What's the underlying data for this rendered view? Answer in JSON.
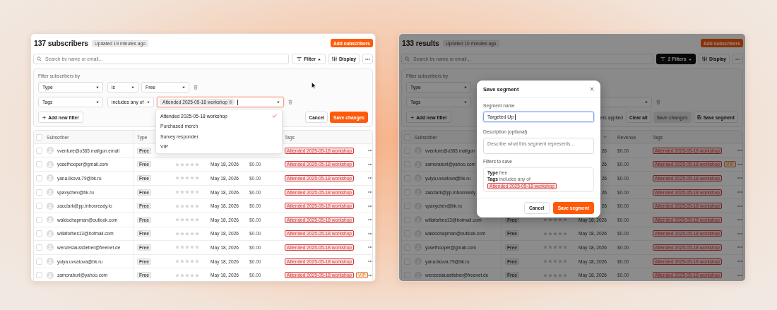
{
  "panels": [
    {
      "kind": "filtering",
      "header": {
        "title": "137 subscribers",
        "updated": "Updated 19 minutes ago",
        "add_button": "Add subscribers"
      },
      "toolbar": {
        "search_placeholder": "Search by name or email...",
        "filter_button": {
          "label": "Filter",
          "active": false
        },
        "display_button": "Display"
      },
      "filter_panel": {
        "heading": "Filter subscribers by",
        "rows": [
          {
            "kind": "select",
            "field": "Type",
            "operator": "is",
            "value": "Free"
          },
          {
            "kind": "tags",
            "field": "Tags",
            "operator": "includes any of",
            "chips": [
              "Attended 2025-05-18 workshop"
            ],
            "focused": true
          }
        ],
        "add_filter": "Add new filter",
        "actions": [
          {
            "kind": "secondary",
            "label": "Cancel",
            "disabled": false
          },
          {
            "kind": "primary",
            "label": "Save changes",
            "disabled": false
          }
        ]
      },
      "dropdown": {
        "options": [
          {
            "label": "Attended 2025-05-18 workshop",
            "selected": true
          },
          {
            "label": "Purchased merch",
            "selected": false
          },
          {
            "label": "Survey responder",
            "selected": false
          },
          {
            "label": "VIP",
            "selected": false
          }
        ]
      },
      "table": {
        "all_checked": false,
        "columns": [
          {
            "label": "Subscriber"
          },
          {
            "label": "Type"
          },
          {},
          {},
          {},
          {
            "label": "Tags"
          }
        ],
        "rows": [
          {
            "checked": false,
            "email": "vventure@o365.mailgun.email",
            "type": "Free",
            "tags": [
              {
                "label": "Attended 2025-05-18 workshop",
                "color": "#d93b3b"
              }
            ]
          },
          {
            "checked": false,
            "email": "yosefhooper@gmail.com",
            "type": "Free",
            "stars": 0,
            "date": "May 18, 2026",
            "revenue": "$0.00",
            "tags": [
              {
                "label": "Attended 2025-05-18 workshop",
                "color": "#d93b3b"
              }
            ]
          },
          {
            "checked": false,
            "email": "yana.likova.79@bk.ru",
            "type": "Free",
            "stars": 0,
            "date": "May 18, 2026",
            "revenue": "$0.00",
            "tags": [
              {
                "label": "Attended 2025-05-18 workshop",
                "color": "#d93b3b"
              }
            ]
          },
          {
            "checked": false,
            "email": "vpavychev@bk.ru",
            "type": "Free",
            "stars": 0,
            "date": "May 18, 2026",
            "revenue": "$0.00",
            "tags": [
              {
                "label": "Attended 2025-05-18 workshop",
                "color": "#d93b3b"
              }
            ]
          },
          {
            "checked": false,
            "email": "zacclark@pp.inboxready.io",
            "type": "Free",
            "stars": 0,
            "date": "May 18, 2026",
            "revenue": "$0.00",
            "tags": [
              {
                "label": "Attended 2025-05-18 workshop",
                "color": "#d93b3b"
              }
            ]
          },
          {
            "checked": false,
            "email": "waldochapman@outlook.com",
            "type": "Free",
            "stars": 0,
            "date": "May 18, 2026",
            "revenue": "$0.00",
            "tags": [
              {
                "label": "Attended 2025-05-18 workshop",
                "color": "#d93b3b"
              }
            ]
          },
          {
            "checked": false,
            "email": "willaforbes13@hotmail.com",
            "type": "Free",
            "stars": 0,
            "date": "May 18, 2026",
            "revenue": "$0.00",
            "tags": [
              {
                "label": "Attended 2025-05-18 workshop",
                "color": "#d93b3b"
              }
            ]
          },
          {
            "checked": false,
            "email": "wenzeslausstieber@freenet.de",
            "type": "Free",
            "stars": 0,
            "date": "May 18, 2026",
            "revenue": "$0.00",
            "tags": [
              {
                "label": "Attended 2025-05-18 workshop",
                "color": "#d93b3b"
              }
            ]
          },
          {
            "checked": false,
            "email": "yulya.uvvatova@bk.ru",
            "type": "Free",
            "stars": 0,
            "date": "May 18, 2026",
            "revenue": "$0.00",
            "tags": [
              {
                "label": "Attended 2025-05-18 workshop",
                "color": "#d93b3b"
              }
            ]
          },
          {
            "checked": false,
            "email": "zamoraburl@yahoo.com",
            "type": "Free",
            "stars": 0,
            "date": "May 18, 2026",
            "revenue": "$0.00",
            "tags": [
              {
                "label": "Attended 2025-05-18 workshop",
                "color": "#d93b3b"
              },
              {
                "label": "VIP",
                "color": "#e2782f"
              }
            ]
          }
        ]
      }
    },
    {
      "kind": "saving",
      "header": {
        "title": "133 results",
        "updated": "Updated 10 minutes ago",
        "add_button": "Add subscribers"
      },
      "toolbar": {
        "search_placeholder": "Search by name or email...",
        "filter_button": {
          "label": "2 Filters",
          "active": true
        },
        "display_button": "Display"
      },
      "filter_panel": {
        "heading": "Filter subscribers by",
        "rows": [
          {
            "kind": "select",
            "field": "Type"
          },
          {
            "kind": "tags",
            "field": "Tags",
            "focused": false
          }
        ],
        "add_filter": "Add new filter",
        "status": "ers applied",
        "actions": [
          {
            "kind": "secondary",
            "label": "Clear all",
            "disabled": false
          },
          {
            "kind": "secondary",
            "label": "Save changes",
            "disabled": true
          },
          {
            "kind": "save",
            "label": "Save segment",
            "disabled": false
          }
        ]
      },
      "table": {
        "all_checked": false,
        "columns": [
          {
            "label": "Subscriber"
          },
          {},
          {},
          {
            "sorted": true
          },
          {
            "label": "Revenue"
          },
          {
            "label": "Tags"
          }
        ],
        "rows": [
          {
            "checked": false,
            "email": "vventure@o365.mailgun",
            "date": "26",
            "revenue": "$0.00",
            "tags": [
              {
                "label": "Attended 2025-05-18 workshop",
                "color": "#772020"
              }
            ]
          },
          {
            "checked": false,
            "email": "zamoraburl@yahoo.com",
            "date": "26",
            "revenue": "$0.00",
            "tags": [
              {
                "label": "Attended 2025-05-18 workshop",
                "color": "#772020"
              },
              {
                "label": "VIP",
                "color": "#7c421a"
              }
            ]
          },
          {
            "checked": false,
            "email": "yulya.uvvatova@bk.ru",
            "date": "26",
            "revenue": "$0.00",
            "tags": [
              {
                "label": "Attended 2025-05-18 workshop",
                "color": "#772020"
              }
            ]
          },
          {
            "checked": false,
            "email": "zacclark@pp.inboxready",
            "date": "26",
            "revenue": "$0.00",
            "tags": [
              {
                "label": "Attended 2025-05-18 workshop",
                "color": "#772020"
              }
            ]
          },
          {
            "checked": false,
            "email": "vpavychev@bk.ru",
            "date": "26",
            "revenue": "$0.00",
            "tags": [
              {
                "label": "Attended 2025-05-18 workshop",
                "color": "#772020"
              }
            ]
          },
          {
            "checked": false,
            "email": "willaforbes13@hotmail.com",
            "type": "Free",
            "stars": 0,
            "date": "May 18, 2026",
            "revenue": "$0.00",
            "tags": [
              {
                "label": "Attended 2025-05-18 workshop",
                "color": "#772020"
              }
            ]
          },
          {
            "checked": false,
            "email": "waldochapman@outlook.com",
            "type": "Free",
            "stars": 0,
            "date": "May 18, 2026",
            "revenue": "$0.00",
            "tags": [
              {
                "label": "Attended 2025-05-18 workshop",
                "color": "#772020"
              }
            ]
          },
          {
            "checked": false,
            "email": "yosefhooper@gmail.com",
            "type": "Free",
            "stars": 0,
            "date": "May 18, 2026",
            "revenue": "$0.00",
            "tags": [
              {
                "label": "Attended 2025-05-18 workshop",
                "color": "#772020"
              }
            ]
          },
          {
            "checked": false,
            "email": "yana.likova.79@bk.ru",
            "type": "Free",
            "stars": 0,
            "date": "May 18, 2026",
            "revenue": "$0.00",
            "tags": [
              {
                "label": "Attended 2025-05-18 workshop",
                "color": "#772020"
              }
            ]
          },
          {
            "checked": false,
            "email": "wenzeslausstieber@freenet.de",
            "type": "Free",
            "stars": 0,
            "date": "May 18, 2026",
            "revenue": "$0.00",
            "tags": [
              {
                "label": "Attended 2025-05-18 workshop",
                "color": "#772020"
              }
            ]
          }
        ]
      },
      "modal": {
        "title": "Save segment",
        "name_label": "Segment name",
        "name_value": "Targeted Up",
        "name_focused": true,
        "description_label": "Description (optional)",
        "description_placeholder": "Describe what this segment represents...",
        "summary_label": "Filters to save",
        "summary": [
          {
            "text": "**Type** free"
          },
          {
            "text": "**Tags** includes any of",
            "tags": [
              {
                "label": "Attended 2025-05-18 workshop",
                "color": "#d93b3b"
              }
            ]
          }
        ],
        "buttons": [
          {
            "kind": "secondary",
            "label": "Cancel"
          },
          {
            "kind": "primary",
            "label": "Save segment"
          }
        ]
      }
    }
  ]
}
